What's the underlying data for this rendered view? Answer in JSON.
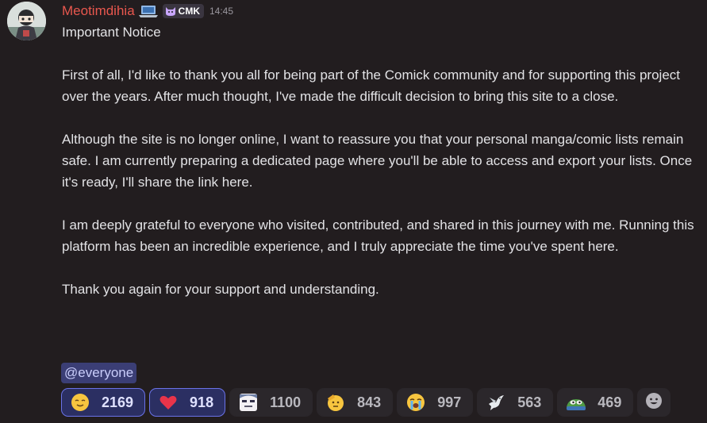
{
  "message": {
    "username": "Meotimdihia",
    "username_color": "#e8574e",
    "tag": "CMK",
    "timestamp": "14:45",
    "paragraphs": [
      "Important Notice",
      "First of all, I'd like to thank you all for being part of the Comick community and for supporting this project over the years. After much thought, I've made the difficult decision to bring this site to a close.",
      "Although the site is no longer online, I want to reassure you that your personal manga/comic lists remain safe. I am currently preparing a dedicated page where you'll be able to access and export your lists. Once it's ready, I'll share the link here.",
      "I am deeply grateful to everyone who visited, contributed, and shared in this journey with me. Running this platform has been an incredible experience, and I truly appreciate the time you've spent here.",
      "Thank you again for your support and understanding."
    ],
    "mention": "@everyone"
  },
  "reactions": [
    {
      "emoji": "relieved-face-emoji",
      "count": "2169",
      "active": true
    },
    {
      "emoji": "red-heart-emoji",
      "count": "918",
      "active": true
    },
    {
      "emoji": "anime-face-custom-emoji",
      "count": "1100",
      "active": false
    },
    {
      "emoji": "saluting-face-emoji",
      "count": "843",
      "active": false
    },
    {
      "emoji": "loudly-crying-face-emoji",
      "count": "997",
      "active": false
    },
    {
      "emoji": "dove-emoji",
      "count": "563",
      "active": false
    },
    {
      "emoji": "pepe-frog-custom-emoji",
      "count": "469",
      "active": false
    }
  ],
  "add_reaction_icon": "smiley-add-reaction-icon",
  "colors": {
    "background": "#221d1f",
    "mention_bg": "#3b3e75",
    "active_reaction_border": "#6a72e8"
  }
}
